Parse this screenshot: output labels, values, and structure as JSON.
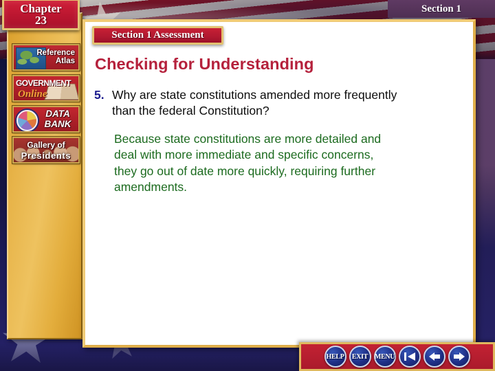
{
  "chapter": {
    "label": "Chapter",
    "number": "23"
  },
  "section_tab": {
    "label": "Section 1"
  },
  "assessment": {
    "banner": "Section 1 Assessment"
  },
  "content": {
    "heading": "Checking for Understanding",
    "question_number": "5.",
    "question": "Why are state constitutions amended more frequently than the federal Constitution?",
    "answer": "Because state constitutions are more detailed and deal with more immediate and specific concerns, they go out of date more quickly, requiring further amendments."
  },
  "sidebar": {
    "items": [
      {
        "id": "reference-atlas",
        "line1": "Reference",
        "line2": "Atlas",
        "icon": "map-icon"
      },
      {
        "id": "government-online",
        "line1": "GOVERNMENT",
        "line2": "Online",
        "icon": "book-icon"
      },
      {
        "id": "data-bank",
        "line1": "DATA",
        "line2": "BANK",
        "icon": "pie-chart-icon"
      },
      {
        "id": "gallery-of-presidents",
        "line1": "Gallery of",
        "line2": "Presidents",
        "icon": "portraits-icon"
      }
    ]
  },
  "navbar": {
    "buttons": [
      {
        "id": "help",
        "label": "HELP",
        "icon": "help-text-icon"
      },
      {
        "id": "exit",
        "label": "EXIT",
        "icon": "exit-text-icon"
      },
      {
        "id": "menu",
        "label": "MENU",
        "icon": "menu-text-icon"
      },
      {
        "id": "first",
        "label": "",
        "icon": "skip-to-start-icon"
      },
      {
        "id": "previous",
        "label": "",
        "icon": "arrow-left-icon"
      },
      {
        "id": "next",
        "label": "",
        "icon": "arrow-right-icon"
      }
    ]
  },
  "colors": {
    "plaque_red": "#bb1630",
    "gold": "#e7b348",
    "heading_crimson": "#b5213c",
    "question_navy": "#1c1c8f",
    "answer_green": "#1c6b1f",
    "nav_blue": "#1f2f86",
    "section_purple": "#4e2f53"
  }
}
